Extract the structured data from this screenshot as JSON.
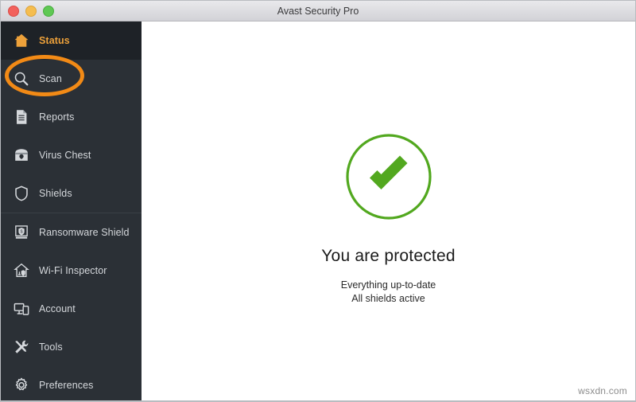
{
  "window": {
    "title": "Avast Security Pro",
    "traffic_lights": [
      {
        "name": "close",
        "color": "#f2615c"
      },
      {
        "name": "minimize",
        "color": "#f5bd4f"
      },
      {
        "name": "zoom",
        "color": "#5fc854"
      }
    ]
  },
  "sidebar": {
    "background": "#2b3036",
    "active_background": "#1e2227",
    "active_color": "#eda13a",
    "label_color": "#d5d8dc",
    "items": [
      {
        "label": "Status",
        "icon": "home-icon",
        "active": true
      },
      {
        "label": "Scan",
        "icon": "magnifier-icon",
        "active": false
      },
      {
        "label": "Reports",
        "icon": "document-icon",
        "active": false
      },
      {
        "label": "Virus Chest",
        "icon": "chest-icon",
        "active": false
      },
      {
        "label": "Shields",
        "icon": "shield-icon",
        "active": false
      },
      {
        "label": "Ransomware Shield",
        "icon": "ransomware-shield-icon",
        "active": false
      },
      {
        "label": "Wi-Fi Inspector",
        "icon": "wifi-house-icon",
        "active": false
      },
      {
        "label": "Account",
        "icon": "devices-icon",
        "active": false
      },
      {
        "label": "Tools",
        "icon": "tools-icon",
        "active": false
      },
      {
        "label": "Preferences",
        "icon": "gear-icon",
        "active": false
      }
    ]
  },
  "highlight": {
    "target": "Scan",
    "color": "#f28a16",
    "shape": "ellipse"
  },
  "main": {
    "status_icon": "green-check-circle-icon",
    "status_color": "#52a81f",
    "title": "You are protected",
    "subtitle_line1": "Everything up-to-date",
    "subtitle_line2": "All shields active"
  },
  "watermark": {
    "text": "wsxdn.com"
  }
}
